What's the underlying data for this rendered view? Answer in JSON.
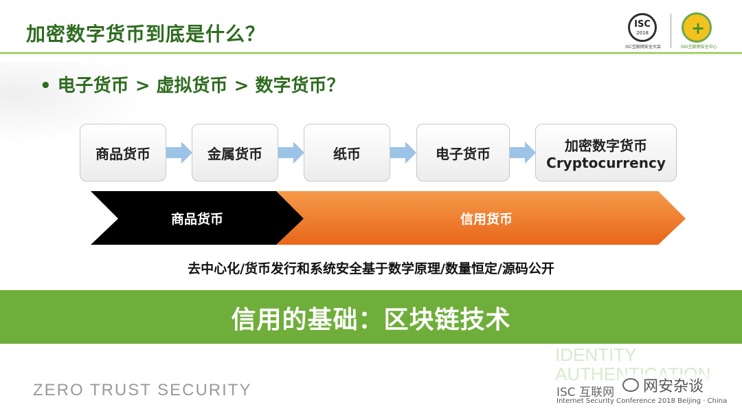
{
  "header": {
    "title": "加密数字货币到底是什么？",
    "isc_logo": {
      "text": "ISC",
      "year": "2018",
      "sub": "ISC互联网安全大会"
    },
    "logo_360_sub": "360互联网安全中心"
  },
  "bullet": "• 电子货币 > 虚拟货币 > 数字货币？",
  "flow": [
    {
      "label": "商品货币"
    },
    {
      "label": "金属货币"
    },
    {
      "label": "纸币"
    },
    {
      "label": "电子货币"
    },
    {
      "label": "加密数字货币",
      "label2": "Cryptocurrency"
    }
  ],
  "chevrons": {
    "left": "商品货币",
    "right": "信用货币"
  },
  "description": "去中心化/货币发行和系统安全基于数学原理/数量恒定/源码公开",
  "band": "信用的基础：区块链技术",
  "footer": {
    "zero_trust": "ZERO TRUST SECURITY",
    "bg_words": [
      "IDENTITY",
      "AUTHENTICATION"
    ],
    "isc_line1": "ISC 互联网",
    "isc_line2": "Internet Security Conference 2018  Beijing · China",
    "wechat": "网安杂谈"
  },
  "colors": {
    "title_green": "#2e6b1f",
    "band_green": "#6fae3a",
    "arrow_blue": "#9dc3e6",
    "chev_black": "#000000",
    "chev_orange": "#f07f2c"
  }
}
